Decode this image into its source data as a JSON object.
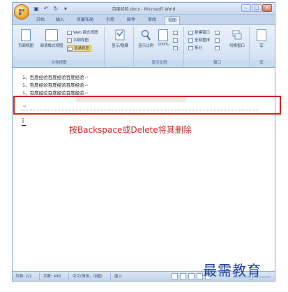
{
  "window": {
    "title": "百度经验.docx - Microsoft Word",
    "controls": [
      "–",
      "□",
      "×"
    ]
  },
  "qat": [
    "save-icon",
    "undo-icon",
    "redo-icon",
    "customize-icon"
  ],
  "tabs": [
    "开始",
    "插入",
    "页面布局",
    "引用",
    "邮件",
    "审阅",
    "视图"
  ],
  "active_tab": "视图",
  "ribbon": {
    "doc_views": {
      "label": "文档视图",
      "print_layout": "页面视图",
      "full_screen_reading": "阅读版式视图",
      "web_layout": "Web 版式视图",
      "outline": "大纲视图",
      "draft": "普通视图"
    },
    "show_hide": {
      "label": "显示/隐藏"
    },
    "zoom": {
      "label": "显示比例",
      "zoom_btn": "显示比例",
      "hundred": "100%"
    },
    "window": {
      "label": "窗口",
      "new_window": "新建窗口",
      "arrange_all": "全部重排",
      "split": "拆分",
      "switch_windows": "切换窗口"
    },
    "macros": {
      "label": "宏",
      "btn": "宏"
    }
  },
  "document": {
    "lines": [
      "1、百度经验百度经验百度经验",
      "1、百度经验百度经验百度经验",
      "1、百度经验百度经验百度经验"
    ],
    "annotation": "按Backspace或Delete将其删除"
  },
  "status": {
    "page": "页面: 2/2",
    "words": "字数: 498",
    "language": "中文(简体，中国)",
    "mode": "插入"
  },
  "brand": "最需教育"
}
